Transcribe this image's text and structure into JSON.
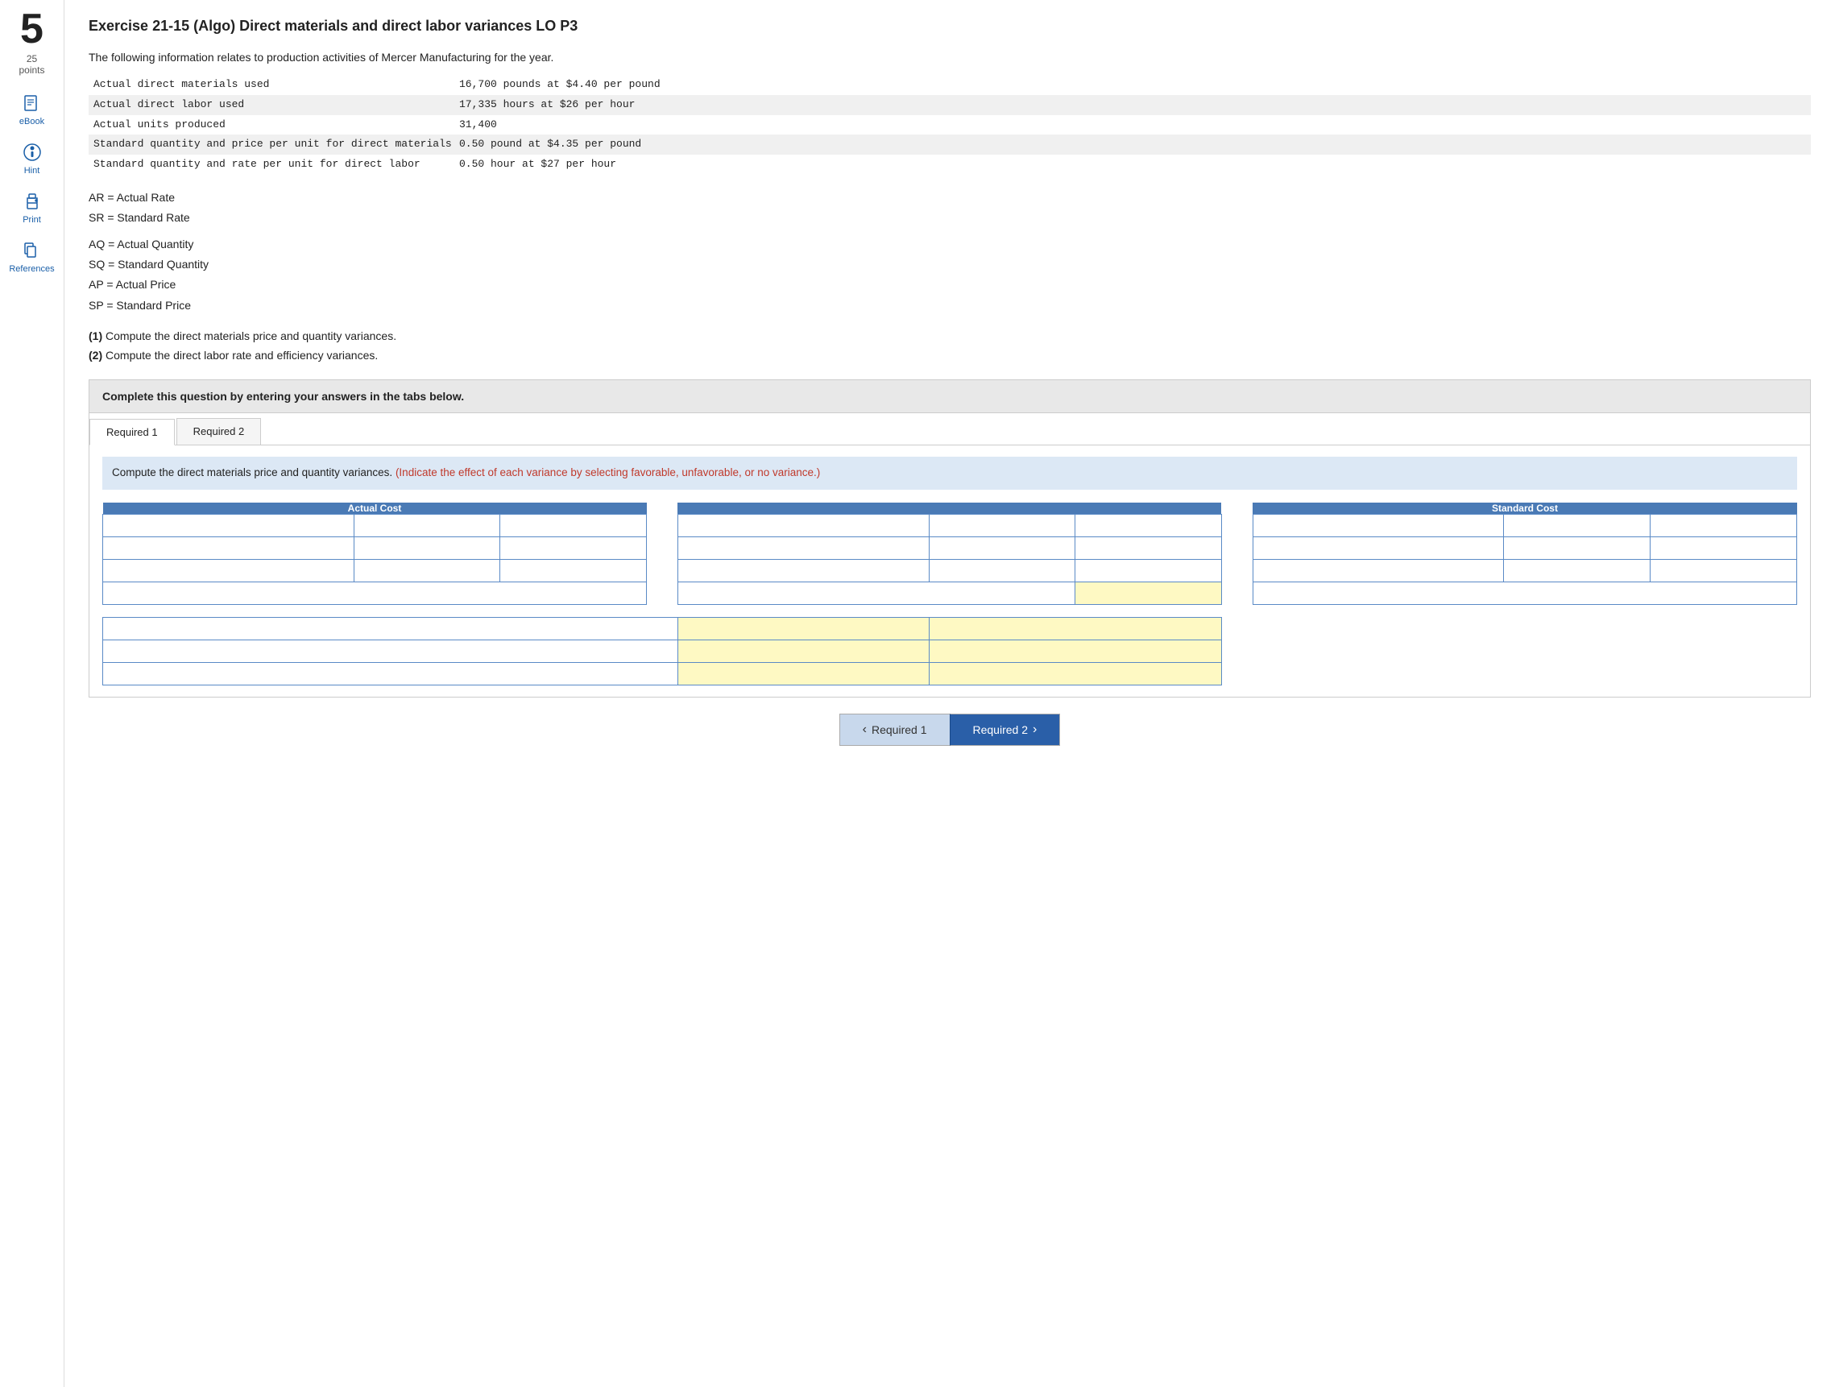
{
  "sidebar": {
    "number": "5",
    "points_value": "25",
    "points_label": "points",
    "items": [
      {
        "id": "ebook",
        "label": "eBook",
        "icon": "book"
      },
      {
        "id": "hint",
        "label": "Hint",
        "icon": "hint"
      },
      {
        "id": "print",
        "label": "Print",
        "icon": "print"
      },
      {
        "id": "references",
        "label": "References",
        "icon": "references"
      }
    ]
  },
  "exercise": {
    "title": "Exercise 21-15 (Algo) Direct materials and direct labor variances LO P3",
    "intro": "The following information relates to production activities of Mercer Manufacturing for the year.",
    "data_rows": [
      {
        "label": "Actual direct materials used",
        "value": "16,700 pounds at $4.40 per pound",
        "shaded": false
      },
      {
        "label": "Actual direct labor used",
        "value": "17,335 hours at $26 per hour",
        "shaded": true
      },
      {
        "label": "Actual units produced",
        "value": "31,400",
        "shaded": false
      },
      {
        "label": "Standard quantity and price per unit for direct materials",
        "value": "0.50 pound at $4.35 per pound",
        "shaded": true
      },
      {
        "label": "Standard quantity and rate per unit for direct labor",
        "value": "0.50 hour at $27 per hour",
        "shaded": false
      }
    ],
    "legend": [
      "AR = Actual Rate",
      "SR = Standard Rate",
      "",
      "AQ = Actual Quantity",
      "SQ = Standard Quantity",
      "AP = Actual Price",
      "SP = Standard Price"
    ],
    "instructions": [
      "(1) Compute the direct materials price and quantity variances.",
      "(2) Compute the direct labor rate and efficiency variances."
    ],
    "complete_box_text": "Complete this question by entering your answers in the tabs below."
  },
  "tabs": [
    {
      "id": "required1",
      "label": "Required 1",
      "active": true
    },
    {
      "id": "required2",
      "label": "Required 2",
      "active": false
    }
  ],
  "tab_content": {
    "instruction": "Compute the direct materials price and quantity variances.",
    "instruction_colored": "(Indicate the effect of each variance by selecting favorable, unfavorable, or no variance.)",
    "actual_cost_header": "Actual Cost",
    "standard_cost_header": "Standard Cost"
  },
  "nav_buttons": {
    "prev_label": "Required 1",
    "next_label": "Required 2"
  }
}
